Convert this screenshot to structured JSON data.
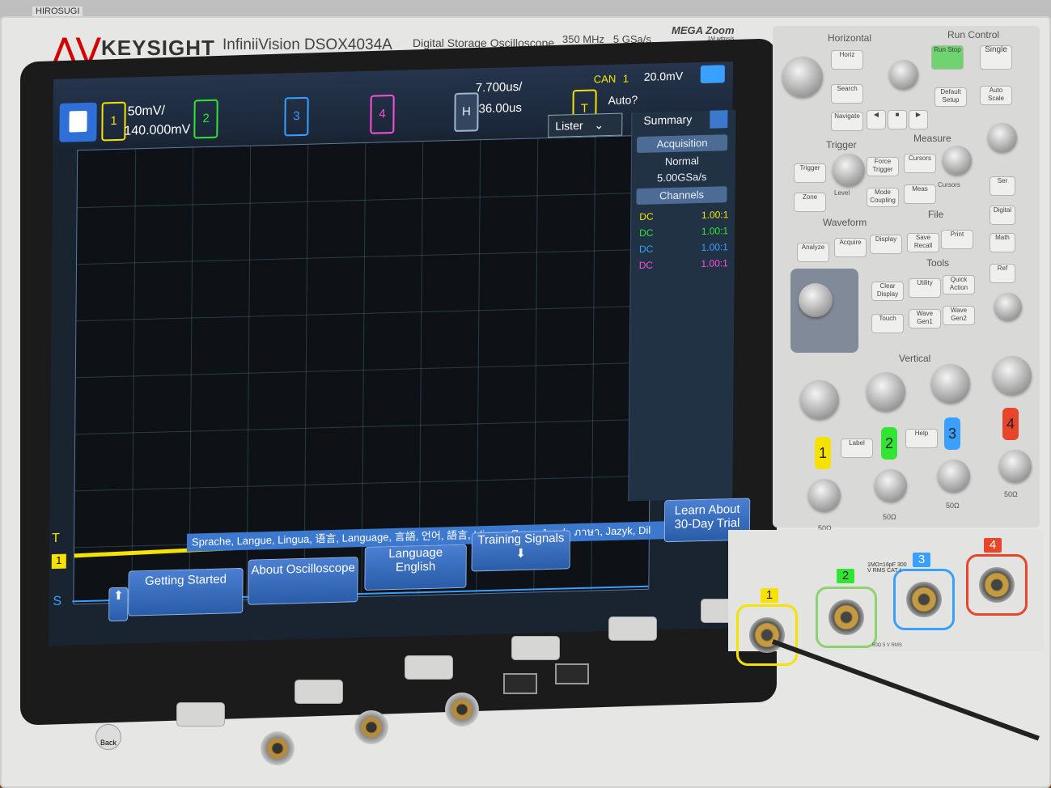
{
  "sticker": "HIROSUGI",
  "brand": "KEYSIGHT",
  "model": "InfiniiVision DSOX4034A",
  "model_desc": "Digital Storage Oscilloscope",
  "spec_bw": "350 MHz",
  "spec_rate": "5 GSa/s",
  "megazoom": "MEGA Zoom",
  "megazoom_sub": "1M wfms/s",
  "topbar": {
    "ch1": "1",
    "ch2": "2",
    "ch3": "3",
    "ch4": "4",
    "ch1_scale": "50mV/",
    "ch1_offset": "140.000mV",
    "h_label": "H",
    "timebase": "7.700us/",
    "delay": "36.00us",
    "t_label": "T",
    "trig_src": "CAN",
    "trig_ch": "1",
    "trig_level": "20.0mV",
    "trig_mode": "Auto?",
    "lister": "Lister"
  },
  "summary": {
    "title": "Summary",
    "acq_header": "Acquisition",
    "acq_mode": "Normal",
    "acq_rate": "5.00GSa/s",
    "channels_header": "Channels",
    "channels": [
      {
        "coupling": "DC",
        "ratio": "1.00:1",
        "color": "#f6e200"
      },
      {
        "coupling": "DC",
        "ratio": "1.00:1",
        "color": "#33e533"
      },
      {
        "coupling": "DC",
        "ratio": "1.00:1",
        "color": "#3aa0ff"
      },
      {
        "coupling": "DC",
        "ratio": "1.00:1",
        "color": "#ff4fd8"
      }
    ]
  },
  "markers": {
    "t": "T",
    "ch1": "1",
    "s": "S"
  },
  "lang_strip": "Sprache, Langue, Lingua, 语言, Language, 言語, 언어, 語言, Idioma, Язык, Język, ภาษา, Jazyk, Dil",
  "softkeys": {
    "getting_started": "Getting Started",
    "about": "About Oscilloscope",
    "language": "Language",
    "language_value": "English",
    "training": "Training Signals",
    "learn": "Learn About 30-Day Trial"
  },
  "front": {
    "back": "Back",
    "horizontal": "Horizontal",
    "horiz": "Horiz",
    "search": "Search",
    "navigate": "Navigate",
    "run_control": "Run Control",
    "run_stop": "Run Stop",
    "single": "Single",
    "default_setup": "Default Setup",
    "auto_scale": "Auto Scale",
    "trigger": "Trigger",
    "trigger_btn": "Trigger",
    "force_trigger": "Force Trigger",
    "zone": "Zone",
    "level": "Level",
    "mode_coupling": "Mode Coupling",
    "measure": "Measure",
    "cursors": "Cursors",
    "meas": "Meas",
    "cursors_knob": "Cursors",
    "waveform": "Waveform",
    "analyze": "Analyze",
    "acquire": "Acquire",
    "display": "Display",
    "file": "File",
    "save_recall": "Save Recall",
    "print": "Print",
    "tools": "Tools",
    "clear_display": "Clear Display",
    "utility": "Utility",
    "quick_action": "Quick Action",
    "touch": "Touch",
    "wave_gen1": "Wave Gen1",
    "wave_gen2": "Wave Gen2",
    "ser": "Ser",
    "digital": "Digital",
    "math": "Math",
    "ref": "Ref",
    "vertical": "Vertical",
    "label": "Label",
    "help": "Help",
    "ch_nums": [
      "1",
      "2",
      "3",
      "4"
    ],
    "ohm": [
      "50Ω",
      "50Ω",
      "50Ω",
      "50Ω"
    ],
    "input_spec": "1MΩ=16pF 300 V RMS CAT I",
    "input_spec2": "50Ω 5 V RMS"
  }
}
